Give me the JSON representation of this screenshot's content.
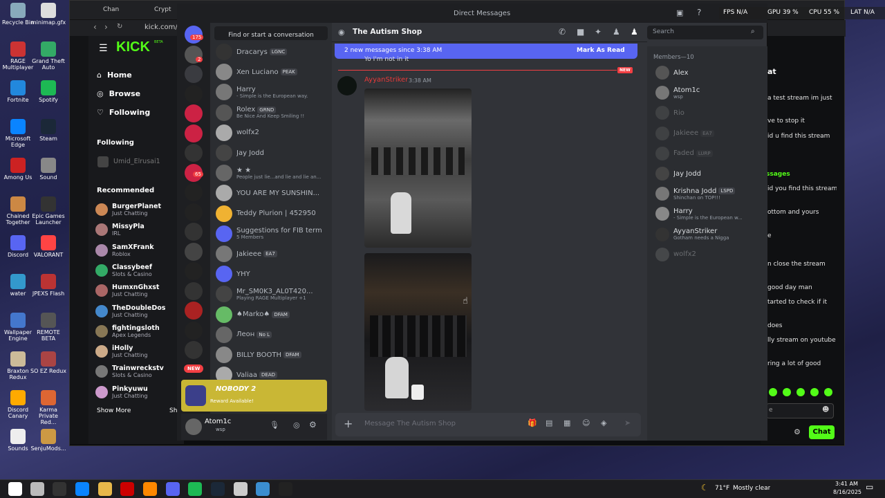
{
  "desktop_icons": [
    "Recycle Bin",
    "minimap.gfx",
    "RAGE Multiplayer",
    "Grand Theft Auto",
    "Fortnite",
    "Spotify",
    "Microsoft Edge",
    "Steam",
    "Among Us",
    "Sound",
    "Chained Together",
    "Epic Games Launcher",
    "Discord",
    "VALORANT",
    "water",
    "JPEXS Flash",
    "Wallpaper Engine",
    "REMOTE BETA",
    "Braxton Redux",
    "SO EZ Redux",
    "Discord Canary",
    "Karma Private Red...",
    "Sounds",
    "SenjuMods..."
  ],
  "browser": {
    "tab1": "Chan",
    "tab2": "Crypt",
    "url": "kick.com/at"
  },
  "overlay": {
    "fps": "FPS N/A",
    "gpu": "GPU 39 %",
    "cpu": "CPU 55 %",
    "lat": "LAT N/A"
  },
  "kick": {
    "logo": "KICK",
    "beta": "BETA",
    "nav": [
      "Home",
      "Browse",
      "Following"
    ],
    "following_header": "Following",
    "following_user": "Umid_Elrusai1",
    "recommended_header": "Recommended",
    "recommended": [
      {
        "name": "BurgerPlanet",
        "cat": "Just Chatting"
      },
      {
        "name": "MissyPla",
        "cat": "IRL"
      },
      {
        "name": "SamXFrank",
        "cat": "Roblox"
      },
      {
        "name": "Classybeef",
        "cat": "Slots & Casino"
      },
      {
        "name": "HumxnGhxst",
        "cat": "Just Chatting"
      },
      {
        "name": "TheDoubleDos",
        "cat": "Just Chatting"
      },
      {
        "name": "fightingsloth",
        "cat": "Apex Legends"
      },
      {
        "name": "iHolly",
        "cat": "Just Chatting"
      },
      {
        "name": "Trainwreckstv",
        "cat": "Slots & Casino"
      },
      {
        "name": "Pinkyuwu",
        "cat": "Just Chatting"
      }
    ],
    "show_more": "Show More",
    "show_short": "Sh"
  },
  "discord": {
    "window_title": "Direct Messages",
    "search_dm": "Find or start a conversation",
    "badge_count": "175",
    "badge2": "2",
    "badge3": "65",
    "new_label": "NEW",
    "dms": [
      {
        "name": "Dracarys",
        "tag": "LGNC",
        "sub": ""
      },
      {
        "name": "Xen Luciano",
        "tag": "PEAK",
        "sub": ""
      },
      {
        "name": "Harry",
        "tag": "",
        "sub": "- Simple is the European way."
      },
      {
        "name": "Rolex",
        "tag": "GRND",
        "sub": "Be Nice And Keep Smiling !!"
      },
      {
        "name": "wolfx2",
        "tag": "",
        "sub": ""
      },
      {
        "name": "Jay Jodd",
        "tag": "",
        "sub": ""
      },
      {
        "name": "★ ★",
        "tag": "",
        "sub": "People just lie...and lie and lie an..."
      },
      {
        "name": "YOU ARE MY SUNSHIN...",
        "tag": "",
        "sub": ""
      },
      {
        "name": "Teddy Plurion | 452950",
        "tag": "",
        "sub": ""
      },
      {
        "name": "Suggestions for FIB term",
        "tag": "",
        "sub": "5 Members"
      },
      {
        "name": "Jakieee",
        "tag": "EA7",
        "sub": ""
      },
      {
        "name": "YHY",
        "tag": "",
        "sub": ""
      },
      {
        "name": "Mr_SM0K3_AL0T420...",
        "tag": "",
        "sub": "Playing RAGE Multiplayer +1"
      },
      {
        "name": "♠Marko♠",
        "tag": "DFAM",
        "sub": ""
      },
      {
        "name": "Леон",
        "tag": "No L",
        "sub": ""
      },
      {
        "name": "BILLY BOOTH",
        "tag": "DFAM",
        "sub": ""
      },
      {
        "name": "Valiaa",
        "tag": "DEAD",
        "sub": ""
      }
    ],
    "reward": {
      "title": "NOBODY 2",
      "sub": "Reward Available!"
    },
    "user": {
      "name": "Atom1c",
      "status": "wsp"
    },
    "channel": {
      "name": "The Autism Shop",
      "search": "Search"
    },
    "banner": {
      "text": "2 new messages since 3:38 AM",
      "action": "Mark As Read"
    },
    "prev_msg": "Yo I'm not in it",
    "new_divider": "NEW",
    "message": {
      "author": "AyyanStriker",
      "time": "3:38 AM"
    },
    "composer_placeholder": "Message The Autism Shop",
    "members_header": "Members—10",
    "members": [
      {
        "name": "Alex",
        "sub": "",
        "dim": false
      },
      {
        "name": "Atom1c",
        "sub": "wsp",
        "dim": false
      },
      {
        "name": "Rio",
        "sub": "",
        "dim": true
      },
      {
        "name": "Jakieee",
        "sub": "",
        "tag": "EA7",
        "dim": true
      },
      {
        "name": "Faded",
        "sub": "",
        "tag": "LURP",
        "dim": true
      },
      {
        "name": "Jay Jodd",
        "sub": "",
        "dim": false
      },
      {
        "name": "Krishna Jodd",
        "sub": "Shinchan on TOP!!!",
        "tag": "LSPD",
        "dim": false
      },
      {
        "name": "Harry",
        "sub": "- Simple is the European w...",
        "dim": false
      },
      {
        "name": "AyyanStriker",
        "sub": "Gotham needs a Nigga",
        "dim": false
      },
      {
        "name": "wolfx2",
        "sub": "",
        "dim": true
      }
    ]
  },
  "kick_chat": {
    "header": "at",
    "messages_header": "ssages",
    "lines": [
      "a test stream im just",
      "ve to stop it",
      "id u find this stream",
      "id you find this stream",
      "ottom and yours",
      "e",
      "n close the stream",
      "good day man",
      "tarted to check if it",
      "does",
      "lly stream on youtube",
      "ring a lot of good"
    ],
    "chat_button": "Chat",
    "input": "e"
  },
  "taskbar": {
    "weather": "71°F",
    "weather_desc": "Mostly clear",
    "time": "3:41 AM",
    "date": "8/16/2025"
  }
}
